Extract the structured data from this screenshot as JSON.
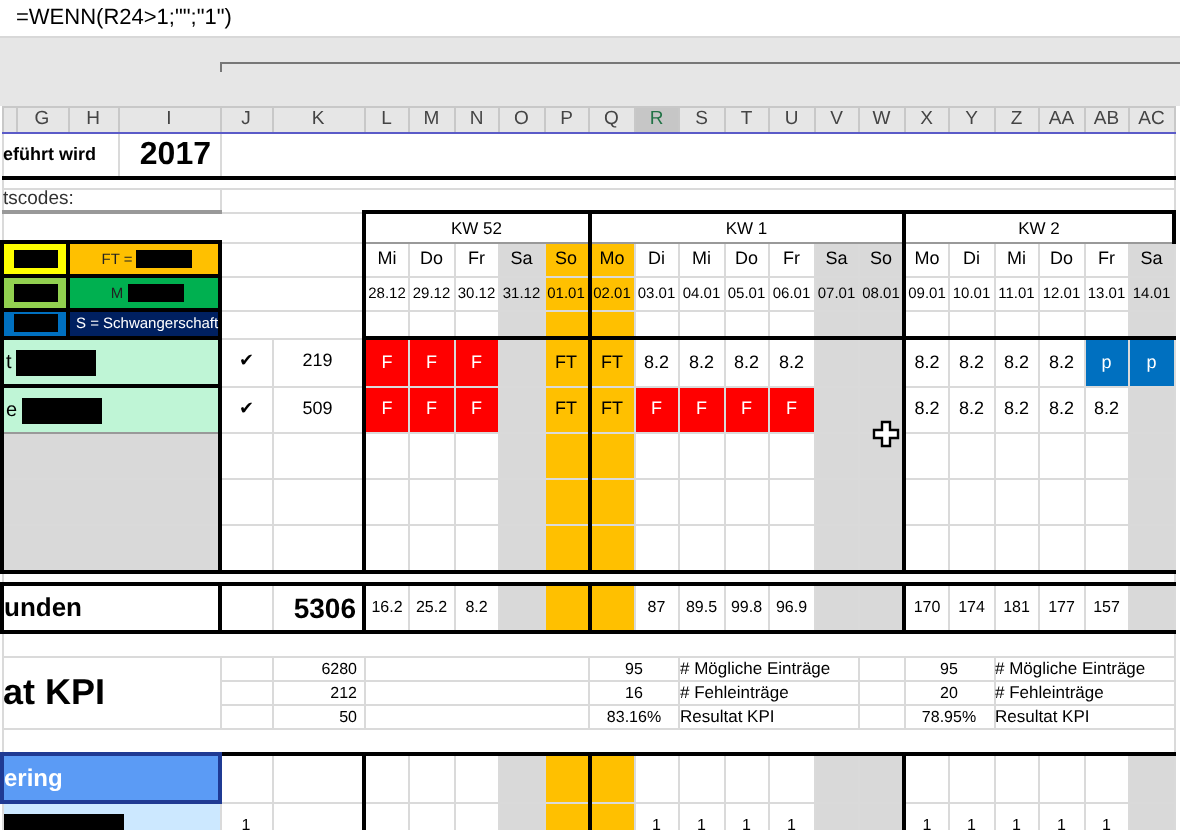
{
  "formula_bar": {
    "formula": "=WENN(R24>1;\"\";\"1\")"
  },
  "columns": [
    {
      "label": "G",
      "selected": false
    },
    {
      "label": "H",
      "selected": false
    },
    {
      "label": "I",
      "selected": false
    },
    {
      "label": "J",
      "selected": false
    },
    {
      "label": "K",
      "selected": false
    },
    {
      "label": "L",
      "selected": false
    },
    {
      "label": "M",
      "selected": false
    },
    {
      "label": "N",
      "selected": false
    },
    {
      "label": "O",
      "selected": false
    },
    {
      "label": "P",
      "selected": false
    },
    {
      "label": "Q",
      "selected": false
    },
    {
      "label": "R",
      "selected": true
    },
    {
      "label": "S",
      "selected": false
    },
    {
      "label": "T",
      "selected": false
    },
    {
      "label": "U",
      "selected": false
    },
    {
      "label": "V",
      "selected": false
    },
    {
      "label": "W",
      "selected": false
    },
    {
      "label": "X",
      "selected": false
    },
    {
      "label": "Y",
      "selected": false
    },
    {
      "label": "Z",
      "selected": false
    },
    {
      "label": "AA",
      "selected": false
    },
    {
      "label": "AB",
      "selected": false
    },
    {
      "label": "AC",
      "selected": false
    }
  ],
  "title": {
    "text": "eführt wird",
    "year": "2017"
  },
  "codes_label": "tscodes:",
  "legend": [
    {
      "text": "FT =",
      "redacted": true
    },
    {
      "text": "M",
      "redacted": true
    },
    {
      "text": "S = Schwangerschaft"
    }
  ],
  "weeks": [
    {
      "label": "KW 52",
      "days": [
        {
          "day": "Mi",
          "date": "28.12",
          "kind": "weekday"
        },
        {
          "day": "Do",
          "date": "29.12",
          "kind": "weekday"
        },
        {
          "day": "Fr",
          "date": "30.12",
          "kind": "weekday"
        },
        {
          "day": "Sa",
          "date": "31.12",
          "kind": "weekend"
        },
        {
          "day": "So",
          "date": "01.01",
          "kind": "holiday"
        }
      ]
    },
    {
      "label": "KW 1",
      "days": [
        {
          "day": "Mo",
          "date": "02.01",
          "kind": "holiday"
        },
        {
          "day": "Di",
          "date": "03.01",
          "kind": "weekday"
        },
        {
          "day": "Mi",
          "date": "04.01",
          "kind": "weekday"
        },
        {
          "day": "Do",
          "date": "05.01",
          "kind": "weekday"
        },
        {
          "day": "Fr",
          "date": "06.01",
          "kind": "weekday"
        },
        {
          "day": "Sa",
          "date": "07.01",
          "kind": "weekend"
        },
        {
          "day": "So",
          "date": "08.01",
          "kind": "weekend"
        }
      ]
    },
    {
      "label": "KW 2",
      "days": [
        {
          "day": "Mo",
          "date": "09.01",
          "kind": "weekday"
        },
        {
          "day": "Di",
          "date": "10.01",
          "kind": "weekday"
        },
        {
          "day": "Mi",
          "date": "11.01",
          "kind": "weekday"
        },
        {
          "day": "Do",
          "date": "12.01",
          "kind": "weekday"
        },
        {
          "day": "Fr",
          "date": "13.01",
          "kind": "weekday"
        },
        {
          "day": "Sa",
          "date": "14.01",
          "kind": "weekend"
        }
      ]
    }
  ],
  "employees": [
    {
      "name_partial": "t",
      "check": "✔",
      "number": "219",
      "cells": [
        {
          "text": "F",
          "kind": "absence"
        },
        {
          "text": "F",
          "kind": "absence"
        },
        {
          "text": "F",
          "kind": "absence"
        },
        {
          "kind": "entry"
        },
        {
          "text": "FT",
          "kind": "entry"
        },
        {
          "text": "FT",
          "kind": "entry"
        },
        {
          "text": "8.2",
          "kind": "entry"
        },
        {
          "text": "8.2",
          "kind": "entry"
        },
        {
          "text": "8.2",
          "kind": "entry"
        },
        {
          "text": "8.2",
          "kind": "entry"
        },
        {
          "kind": "entry"
        },
        {
          "kind": "entry"
        },
        {
          "text": "8.2",
          "kind": "entry"
        },
        {
          "text": "8.2",
          "kind": "entry"
        },
        {
          "text": "8.2",
          "kind": "entry"
        },
        {
          "text": "8.2",
          "kind": "entry"
        },
        {
          "text": "p",
          "kind": "planned"
        },
        {
          "text": "p",
          "kind": "planned"
        }
      ]
    },
    {
      "name_partial": "e",
      "check": "✔",
      "number": "509",
      "cells": [
        {
          "text": "F",
          "kind": "absence"
        },
        {
          "text": "F",
          "kind": "absence"
        },
        {
          "text": "F",
          "kind": "absence"
        },
        {
          "kind": "entry"
        },
        {
          "text": "FT",
          "kind": "entry"
        },
        {
          "text": "FT",
          "kind": "entry"
        },
        {
          "text": "F",
          "kind": "absence"
        },
        {
          "text": "F",
          "kind": "absence"
        },
        {
          "text": "F",
          "kind": "absence"
        },
        {
          "text": "F",
          "kind": "absence"
        },
        {
          "kind": "entry"
        },
        {
          "kind": "entry"
        },
        {
          "text": "8.2",
          "kind": "entry"
        },
        {
          "text": "8.2",
          "kind": "entry"
        },
        {
          "text": "8.2",
          "kind": "entry"
        },
        {
          "text": "8.2",
          "kind": "entry"
        },
        {
          "text": "8.2",
          "kind": "entry"
        },
        {
          "kind": "entry"
        }
      ]
    }
  ],
  "totals": {
    "label": "unden",
    "total": "5306",
    "cells": [
      {
        "text": "16.2",
        "kind": "entry"
      },
      {
        "text": "25.2",
        "kind": "entry"
      },
      {
        "text": "8.2",
        "kind": "entry"
      },
      {
        "kind": "entry"
      },
      {
        "kind": "entry"
      },
      {
        "kind": "entry"
      },
      {
        "text": "87",
        "kind": "entry"
      },
      {
        "text": "89.5",
        "kind": "entry"
      },
      {
        "text": "99.8",
        "kind": "entry"
      },
      {
        "text": "96.9",
        "kind": "entry"
      },
      {
        "kind": "entry"
      },
      {
        "kind": "entry"
      },
      {
        "text": "170",
        "kind": "entry"
      },
      {
        "text": "174",
        "kind": "entry"
      },
      {
        "text": "181",
        "kind": "entry"
      },
      {
        "text": "177",
        "kind": "entry"
      },
      {
        "text": "157",
        "kind": "entry"
      },
      {
        "kind": "entry"
      }
    ]
  },
  "kpi": {
    "label": "at KPI",
    "values": [
      "6280",
      "212",
      "50"
    ],
    "weeks": [
      {
        "rows": [
          {
            "value": "95",
            "label": "# Mögliche Einträge"
          },
          {
            "value": "16",
            "label": "# Fehleinträge"
          },
          {
            "value": "83.16%",
            "label": "Resultat KPI"
          }
        ]
      },
      {
        "rows": [
          {
            "value": "95",
            "label": "# Mögliche Einträge"
          },
          {
            "value": "20",
            "label": "# Fehleinträge"
          },
          {
            "value": "78.95%",
            "label": "Resultat KPI"
          }
        ]
      }
    ]
  },
  "section": {
    "title": "ering",
    "row": {
      "value": "1",
      "cells": [
        {
          "kind": "entry"
        },
        {
          "kind": "entry"
        },
        {
          "kind": "entry"
        },
        {
          "kind": "entry"
        },
        {
          "kind": "entry"
        },
        {
          "kind": "entry"
        },
        {
          "text": "1",
          "kind": "entry"
        },
        {
          "text": "1",
          "kind": "entry"
        },
        {
          "text": "1",
          "kind": "entry"
        },
        {
          "text": "1",
          "kind": "entry"
        },
        {
          "kind": "entry"
        },
        {
          "kind": "entry"
        },
        {
          "text": "1",
          "kind": "entry"
        },
        {
          "text": "1",
          "kind": "entry"
        },
        {
          "text": "1",
          "kind": "entry"
        },
        {
          "text": "1",
          "kind": "entry"
        },
        {
          "text": "1",
          "kind": "entry"
        },
        {
          "kind": "entry"
        }
      ]
    }
  }
}
